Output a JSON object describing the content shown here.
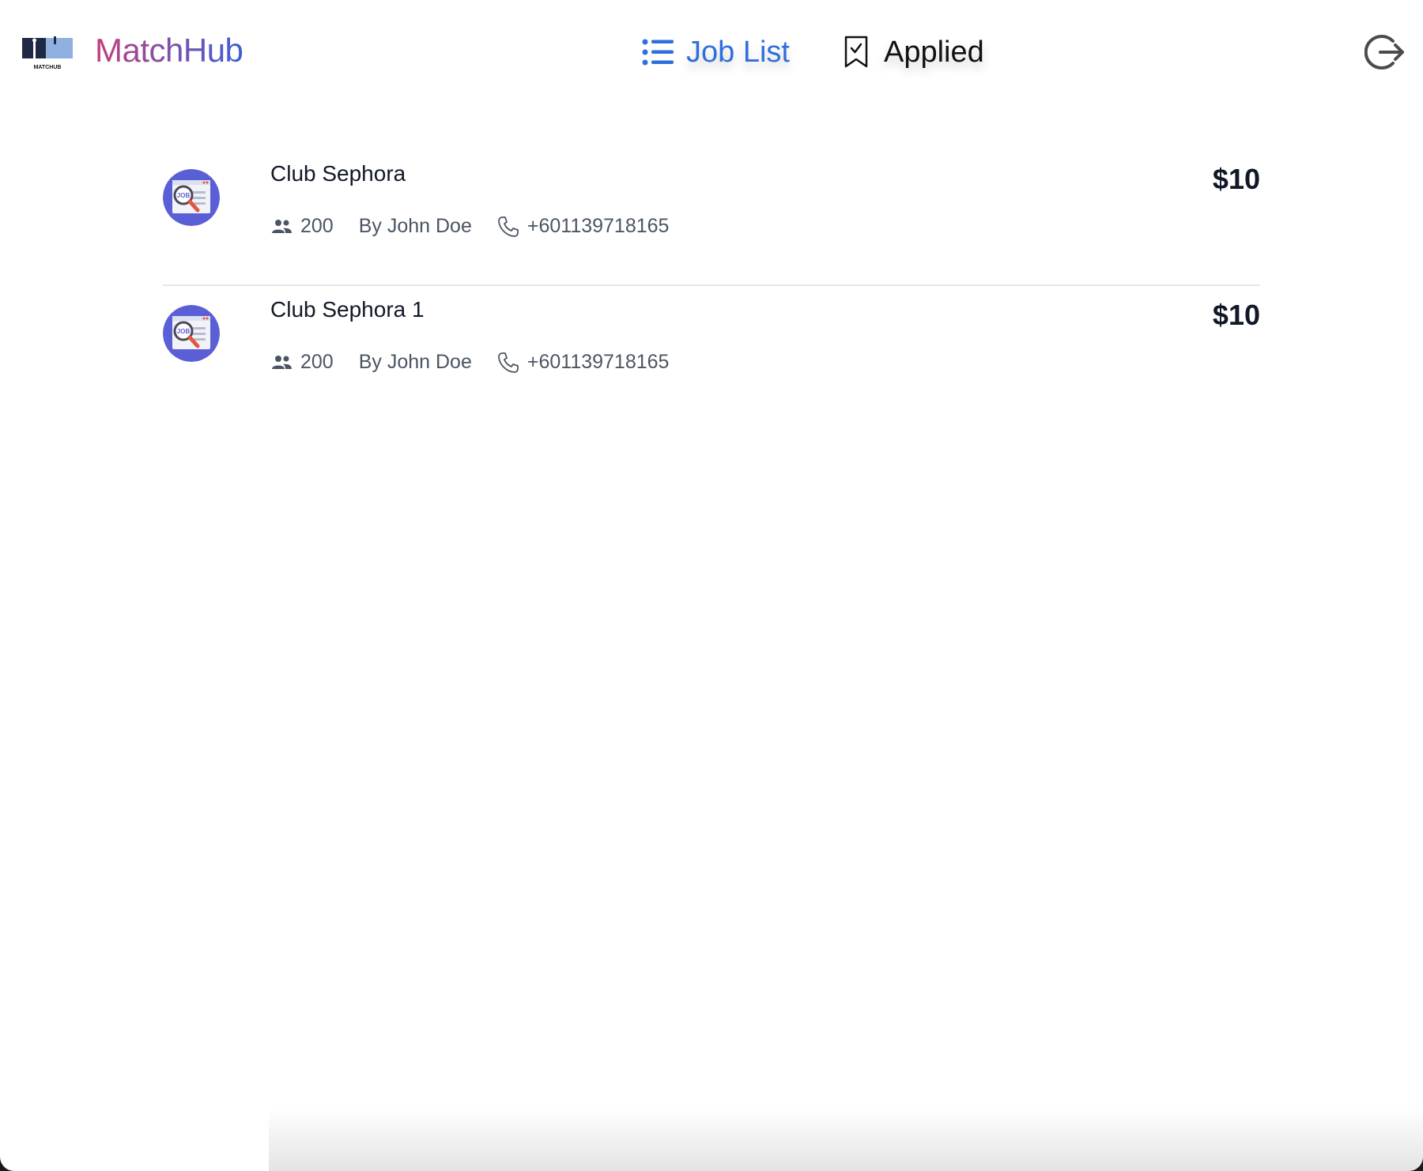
{
  "header": {
    "logo_text": "MATCHUB",
    "brand": "MatchHub",
    "nav": [
      {
        "label": "Job List",
        "icon": "list-icon",
        "active": true
      },
      {
        "label": "Applied",
        "icon": "bookmark-check-icon",
        "active": false
      }
    ],
    "logout_icon": "logout-icon"
  },
  "colors": {
    "accent": "#2f6fdc",
    "brand_gradient_start": "#c2407c",
    "brand_gradient_end": "#3b5fd6",
    "text_primary": "#111827",
    "text_secondary": "#4b5563",
    "divider": "#e5e7eb"
  },
  "jobs": [
    {
      "title": "Club Sephora",
      "price": "$10",
      "count": "200",
      "author": "By John Doe",
      "phone": "+601139718165",
      "avatar_text": "JOB"
    },
    {
      "title": "Club Sephora 1",
      "price": "$10",
      "count": "200",
      "author": "By John Doe",
      "phone": "+601139718165",
      "avatar_text": "JOB"
    }
  ]
}
